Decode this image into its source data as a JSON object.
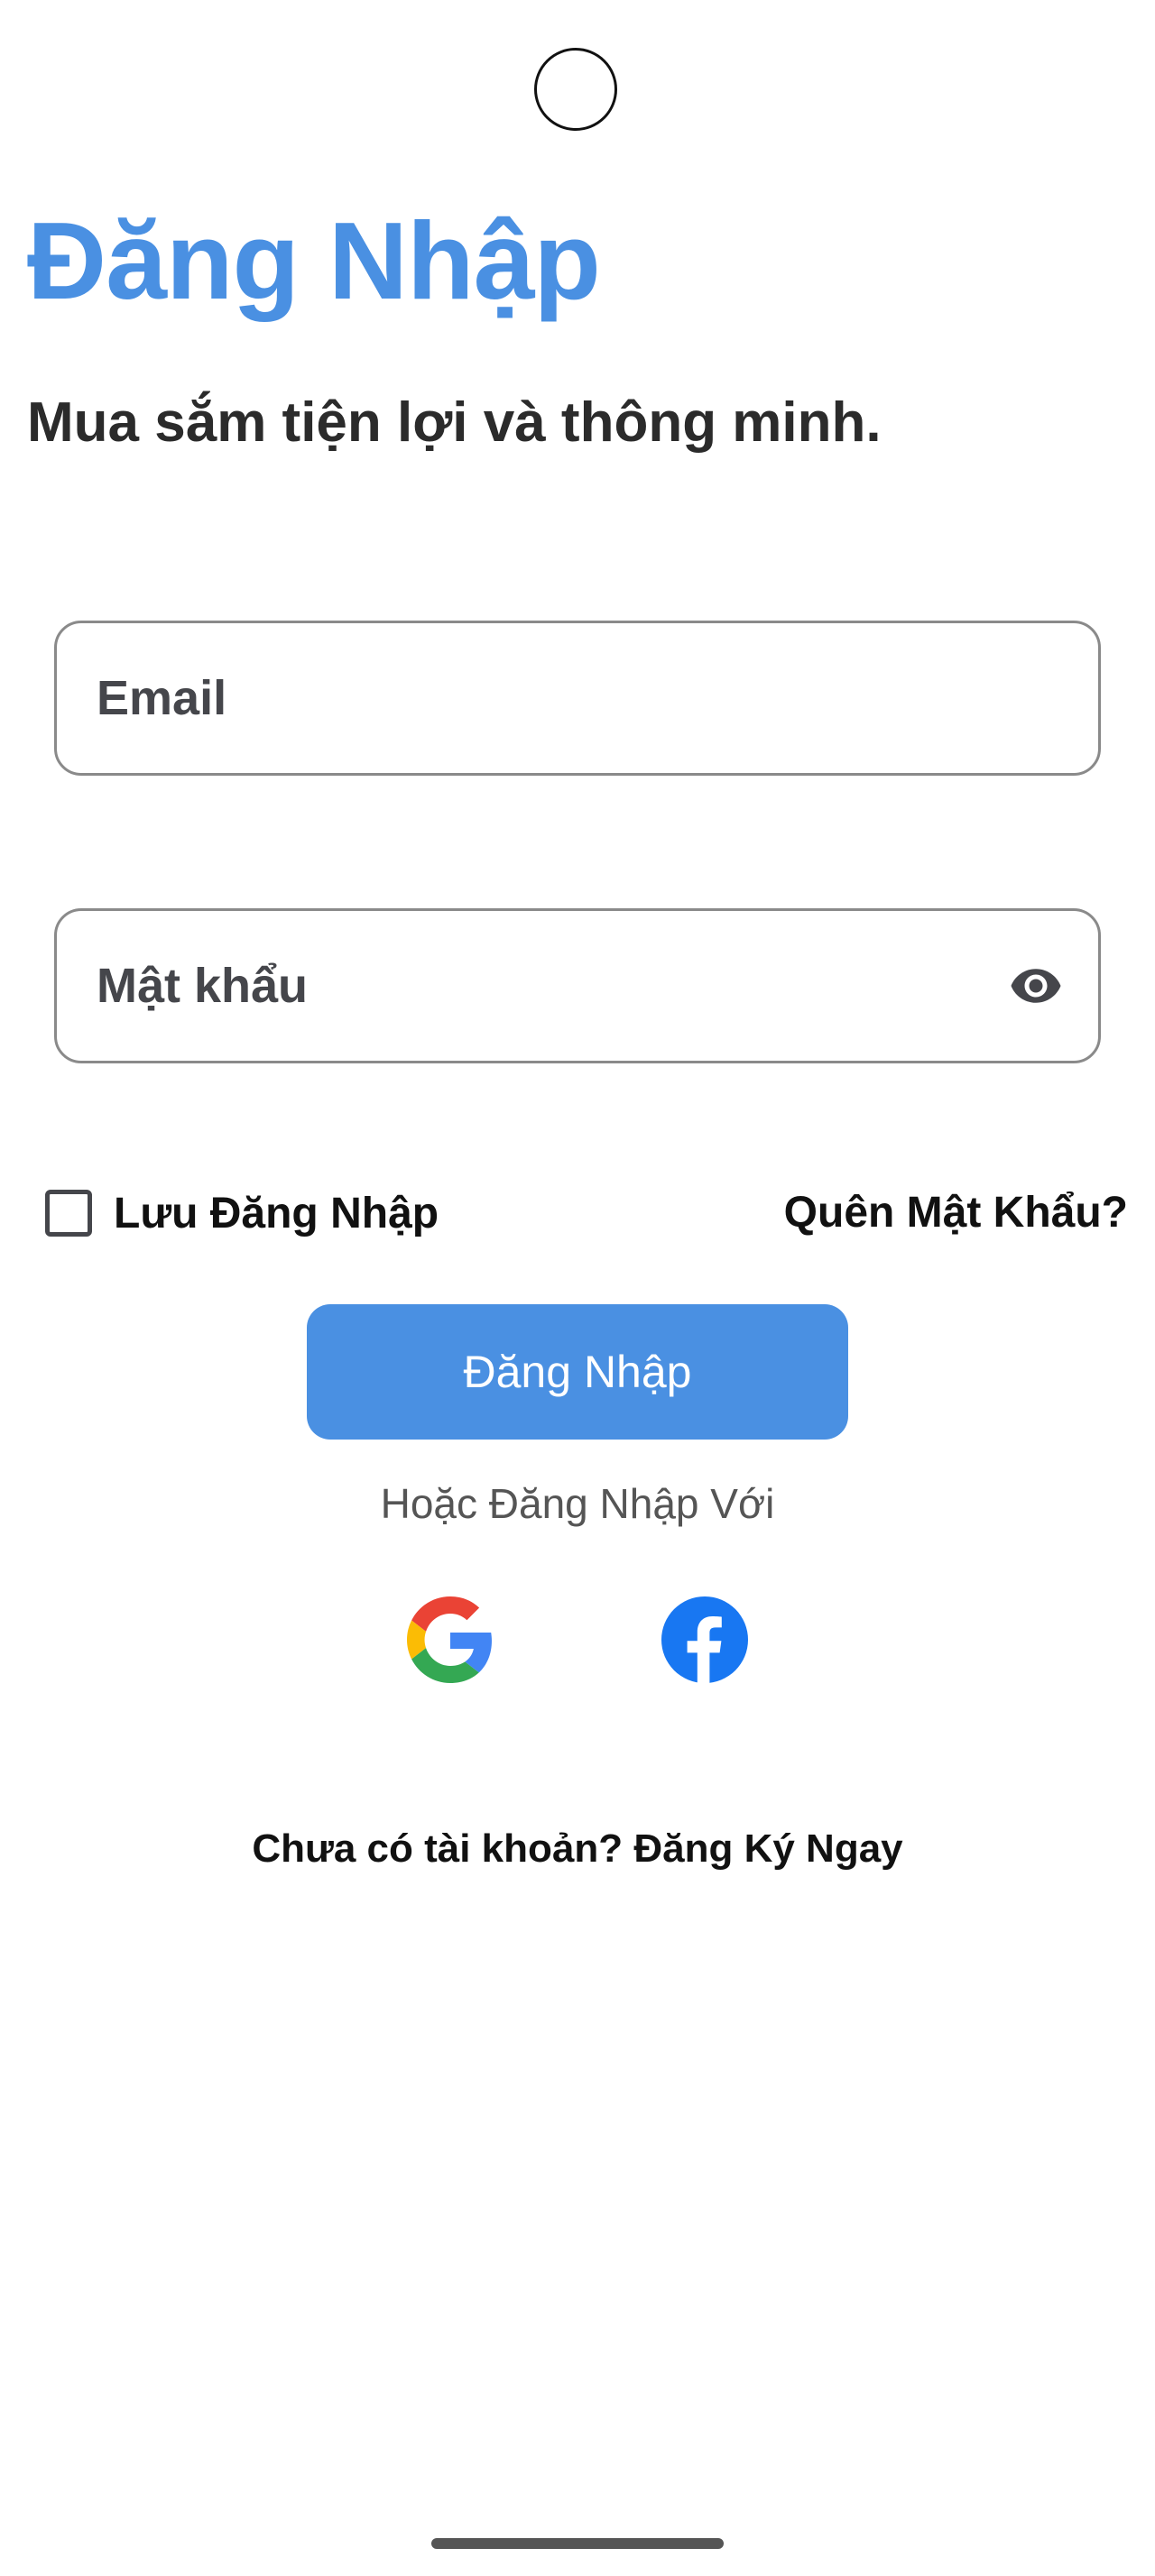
{
  "login": {
    "title": "Đăng Nhập",
    "subtitle": "Mua sắm tiện lợi và thông minh.",
    "email_placeholder": "Email",
    "password_placeholder": "Mật khẩu",
    "remember_label": "Lưu Đăng Nhập",
    "remember_checked": false,
    "forgot_label": "Quên Mật Khẩu?",
    "submit_label": "Đăng Nhập",
    "or_text": "Hoặc Đăng Nhập Với",
    "social": [
      "google-icon",
      "facebook-icon"
    ],
    "signup_text": "Chưa có tài khoản? Đăng Ký Ngay"
  },
  "colors": {
    "primary": "#4a90e2",
    "text_dark": "#2b2b2b",
    "field_border": "#8a8a8a",
    "google_red": "#EA4335",
    "google_yellow": "#FBBC05",
    "google_green": "#34A853",
    "google_blue": "#4285F4",
    "facebook_blue": "#1877F2"
  }
}
